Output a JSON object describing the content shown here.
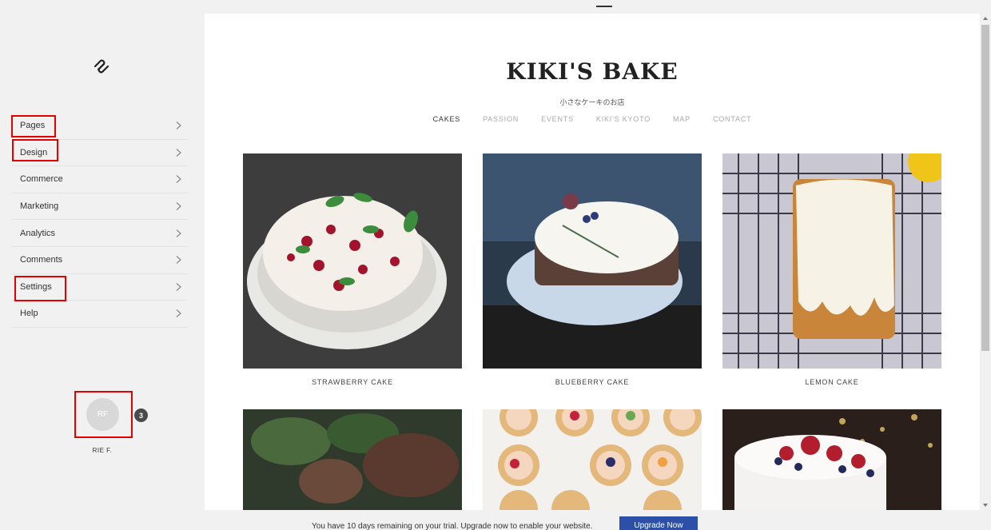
{
  "sidebar": {
    "logo_icon": "squarespace-logo-icon",
    "items": [
      {
        "label": "Pages",
        "icon": "chevron-right-icon"
      },
      {
        "label": "Design",
        "icon": "chevron-right-icon"
      },
      {
        "label": "Commerce",
        "icon": "chevron-right-icon"
      },
      {
        "label": "Marketing",
        "icon": "chevron-right-icon"
      },
      {
        "label": "Analytics",
        "icon": "chevron-right-icon"
      },
      {
        "label": "Comments",
        "icon": "chevron-right-icon"
      },
      {
        "label": "Settings",
        "icon": "chevron-right-icon"
      },
      {
        "label": "Help",
        "icon": "chevron-right-icon"
      }
    ],
    "user": {
      "initials": "RF",
      "name": "RIE F.",
      "notifications": "3"
    }
  },
  "site": {
    "title": "KIKI'S BAKE",
    "tagline": "小さなケーキのお店",
    "nav": [
      "CAKES",
      "PASSION",
      "EVENTS",
      "KIKI'S KYOTO",
      "MAP",
      "CONTACT"
    ],
    "active_nav": "CAKES",
    "products": [
      {
        "caption": "STRAWBERRY CAKE"
      },
      {
        "caption": "BLUEBERRY CAKE"
      },
      {
        "caption": "LEMON CAKE"
      }
    ]
  },
  "trial": {
    "message": "You have 10 days remaining on your trial. Upgrade now to enable your website.",
    "button": "Upgrade Now"
  },
  "colors": {
    "highlight": "#e60000",
    "upgrade_button": "#2c4fa8",
    "sidebar_bg": "#f1f1f1"
  }
}
